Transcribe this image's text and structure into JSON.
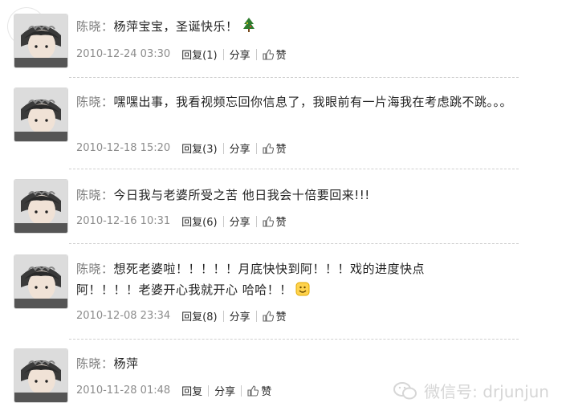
{
  "posts": [
    {
      "author": "陈晓：",
      "content": "杨萍宝宝，圣诞快乐！",
      "timestamp": "2010-12-24 03:30",
      "reply": "回复(1)",
      "share": "分享",
      "like": "赞",
      "emoji": "christmas-tree-icon"
    },
    {
      "author": "陈晓：",
      "content": "嘿嘿出事，我看视频忘回你信息了，我眼前有一片海我在考虑跳不跳。。。",
      "timestamp": "2010-12-18 15:20",
      "reply": "回复(3)",
      "share": "分享",
      "like": "赞"
    },
    {
      "author": "陈晓：",
      "content": "今日我与老婆所受之苦 他日我会十倍要回来!!!",
      "timestamp": "2010-12-16 10:31",
      "reply": "回复(6)",
      "share": "分享",
      "like": "赞"
    },
    {
      "author": "陈晓：",
      "content": "想死老婆啦！！！！！月底快快到阿！！！戏的进度快点阿！！！！老婆开心我就开心 哈哈！！",
      "timestamp": "2010-12-08 23:34",
      "reply": "回复(8)",
      "share": "分享",
      "like": "赞",
      "emoji": "smile-face-icon"
    },
    {
      "author": "陈晓：",
      "content": "杨萍",
      "timestamp": "2010-11-28 01:48",
      "reply": "回复",
      "share": "分享",
      "like": "赞"
    }
  ],
  "watermark": "微信号: drjunjun",
  "colors": {
    "text": "#222222",
    "meta": "#8c8c8c",
    "badge_orange": "#f07a22"
  }
}
